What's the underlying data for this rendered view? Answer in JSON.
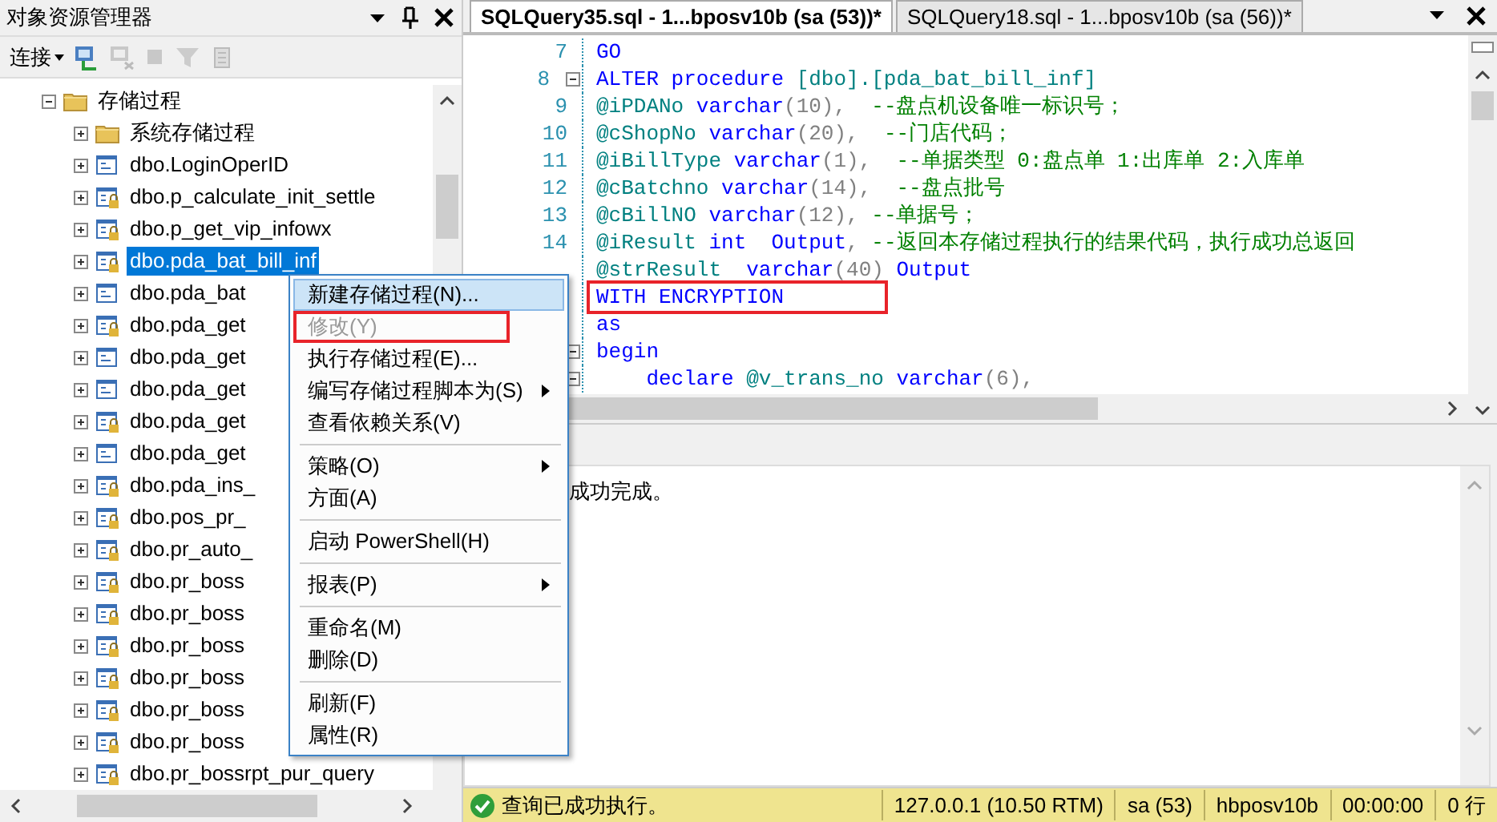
{
  "explorer": {
    "title": "对象资源管理器",
    "connect_label": "连接",
    "tree": [
      {
        "label": "存储过程",
        "kind": "folder",
        "expanded": true,
        "selected": false,
        "children": [
          {
            "label": "系统存储过程",
            "kind": "folder",
            "expanded": false,
            "selected": false
          },
          {
            "label": "dbo.LoginOperID",
            "kind": "procedure",
            "expanded": false,
            "selected": false
          },
          {
            "label": "dbo.p_calculate_init_settle",
            "kind": "locked",
            "expanded": false,
            "selected": false
          },
          {
            "label": "dbo.p_get_vip_infowx",
            "kind": "locked",
            "expanded": false,
            "selected": false
          },
          {
            "label": "dbo.pda_bat_bill_inf",
            "kind": "locked",
            "expanded": false,
            "selected": true
          },
          {
            "label": "dbo.pda_bat",
            "kind": "procedure",
            "expanded": false,
            "selected": false
          },
          {
            "label": "dbo.pda_get",
            "kind": "locked",
            "expanded": false,
            "selected": false
          },
          {
            "label": "dbo.pda_get",
            "kind": "procedure",
            "expanded": false,
            "selected": false
          },
          {
            "label": "dbo.pda_get",
            "kind": "procedure",
            "expanded": false,
            "selected": false
          },
          {
            "label": "dbo.pda_get",
            "kind": "locked",
            "expanded": false,
            "selected": false
          },
          {
            "label": "dbo.pda_get",
            "kind": "procedure",
            "expanded": false,
            "selected": false
          },
          {
            "label": "dbo.pda_ins_",
            "kind": "locked",
            "expanded": false,
            "selected": false
          },
          {
            "label": "dbo.pos_pr_",
            "kind": "locked",
            "expanded": false,
            "selected": false
          },
          {
            "label": "dbo.pr_auto_",
            "kind": "locked",
            "expanded": false,
            "selected": false
          },
          {
            "label": "dbo.pr_boss",
            "kind": "locked",
            "expanded": false,
            "selected": false
          },
          {
            "label": "dbo.pr_boss",
            "kind": "locked",
            "expanded": false,
            "selected": false
          },
          {
            "label": "dbo.pr_boss",
            "kind": "locked",
            "expanded": false,
            "selected": false
          },
          {
            "label": "dbo.pr_boss",
            "kind": "locked",
            "expanded": false,
            "selected": false
          },
          {
            "label": "dbo.pr_boss",
            "kind": "locked",
            "expanded": false,
            "selected": false
          },
          {
            "label": "dbo.pr_boss",
            "kind": "locked",
            "expanded": false,
            "selected": false
          },
          {
            "label": "dbo.pr_bossrpt_pur_query",
            "kind": "locked",
            "expanded": false,
            "selected": false
          }
        ]
      }
    ]
  },
  "tabs": [
    {
      "label": "SQLQuery35.sql - 1...bposv10b (sa (53))*",
      "selected": true
    },
    {
      "label": "SQLQuery18.sql - 1...bposv10b (sa (56))*",
      "selected": false
    }
  ],
  "editor": {
    "lines": [
      {
        "number": "7",
        "tokens": [
          {
            "kind": "keyword",
            "text": "GO"
          }
        ]
      },
      {
        "number": "8",
        "fold": true,
        "tokens": [
          {
            "kind": "keyword",
            "text": "ALTER procedure "
          },
          {
            "kind": "name",
            "text": "[dbo].[pda_bat_bill_inf]"
          }
        ]
      },
      {
        "number": "9",
        "tokens": [
          {
            "kind": "name",
            "text": "@iPDANo "
          },
          {
            "kind": "keyword",
            "text": "varchar"
          },
          {
            "kind": "punct",
            "text": "(10),  "
          },
          {
            "kind": "comment",
            "text": "--盘点机设备唯一标识号；"
          }
        ]
      },
      {
        "number": "10",
        "tokens": [
          {
            "kind": "name",
            "text": "@cShopNo "
          },
          {
            "kind": "keyword",
            "text": "varchar"
          },
          {
            "kind": "punct",
            "text": "(20),  "
          },
          {
            "kind": "comment",
            "text": "--门店代码；"
          }
        ]
      },
      {
        "number": "11",
        "tokens": [
          {
            "kind": "name",
            "text": "@iBillType "
          },
          {
            "kind": "keyword",
            "text": "varchar"
          },
          {
            "kind": "punct",
            "text": "(1),  "
          },
          {
            "kind": "comment",
            "text": "--单据类型 0:盘点单 1:出库单 2:入库单"
          }
        ]
      },
      {
        "number": "12",
        "tokens": [
          {
            "kind": "name",
            "text": "@cBatchno "
          },
          {
            "kind": "keyword",
            "text": "varchar"
          },
          {
            "kind": "punct",
            "text": "(14),  "
          },
          {
            "kind": "comment",
            "text": "--盘点批号"
          }
        ]
      },
      {
        "number": "13",
        "tokens": [
          {
            "kind": "name",
            "text": "@cBillNO "
          },
          {
            "kind": "keyword",
            "text": "varchar"
          },
          {
            "kind": "punct",
            "text": "(12), "
          },
          {
            "kind": "comment",
            "text": "--单据号；"
          }
        ]
      },
      {
        "number": "14",
        "tokens": [
          {
            "kind": "name",
            "text": "@iResult "
          },
          {
            "kind": "keyword",
            "text": "int  Output"
          },
          {
            "kind": "punct",
            "text": ", "
          },
          {
            "kind": "comment",
            "text": "--返回本存储过程执行的结果代码，执行成功总返回"
          }
        ]
      },
      {
        "tokens": [
          {
            "kind": "name",
            "text": "@strResult  "
          },
          {
            "kind": "keyword",
            "text": "varchar"
          },
          {
            "kind": "punct",
            "text": "(40) "
          },
          {
            "kind": "keyword",
            "text": "Output"
          }
        ]
      },
      {
        "annotated": true,
        "tokens": [
          {
            "kind": "keyword",
            "text": "WITH ENCRYPTION"
          }
        ]
      },
      {
        "tokens": [
          {
            "kind": "keyword",
            "text": "as"
          }
        ]
      },
      {
        "fold": true,
        "tokens": [
          {
            "kind": "keyword",
            "text": "begin"
          }
        ]
      },
      {
        "fold": true,
        "tokens": [
          {
            "kind": "keyword",
            "text": "    declare "
          },
          {
            "kind": "name",
            "text": "@v_trans_no "
          },
          {
            "kind": "keyword",
            "text": "varchar"
          },
          {
            "kind": "punct",
            "text": "(6),"
          }
        ]
      }
    ]
  },
  "messages": {
    "text": "成功完成。"
  },
  "context_menu": [
    {
      "kind": "item",
      "label": "新建存储过程(N)...",
      "selected": true,
      "disabled": false,
      "submenu": false,
      "annotated": false
    },
    {
      "kind": "item",
      "label": "修改(Y)",
      "selected": false,
      "disabled": true,
      "submenu": false,
      "annotated": true
    },
    {
      "kind": "item",
      "label": "执行存储过程(E)...",
      "selected": false,
      "disabled": false,
      "submenu": false,
      "annotated": false
    },
    {
      "kind": "item",
      "label": "编写存储过程脚本为(S)",
      "selected": false,
      "disabled": false,
      "submenu": true,
      "annotated": false
    },
    {
      "kind": "item",
      "label": "查看依赖关系(V)",
      "selected": false,
      "disabled": false,
      "submenu": false,
      "annotated": false
    },
    {
      "kind": "separator"
    },
    {
      "kind": "item",
      "label": "策略(O)",
      "selected": false,
      "disabled": false,
      "submenu": true,
      "annotated": false
    },
    {
      "kind": "item",
      "label": "方面(A)",
      "selected": false,
      "disabled": false,
      "submenu": false,
      "annotated": false
    },
    {
      "kind": "separator"
    },
    {
      "kind": "item",
      "label": "启动 PowerShell(H)",
      "selected": false,
      "disabled": false,
      "submenu": false,
      "annotated": false
    },
    {
      "kind": "separator"
    },
    {
      "kind": "item",
      "label": "报表(P)",
      "selected": false,
      "disabled": false,
      "submenu": true,
      "annotated": false
    },
    {
      "kind": "separator"
    },
    {
      "kind": "item",
      "label": "重命名(M)",
      "selected": false,
      "disabled": false,
      "submenu": false,
      "annotated": false
    },
    {
      "kind": "item",
      "label": "删除(D)",
      "selected": false,
      "disabled": false,
      "submenu": false,
      "annotated": false
    },
    {
      "kind": "separator"
    },
    {
      "kind": "item",
      "label": "刷新(F)",
      "selected": false,
      "disabled": false,
      "submenu": false,
      "annotated": false
    },
    {
      "kind": "item",
      "label": "属性(R)",
      "selected": false,
      "disabled": false,
      "submenu": false,
      "annotated": false
    }
  ],
  "status_bar": {
    "message": "查询已成功执行。",
    "fields": [
      "127.0.0.1 (10.50 RTM)",
      "sa (53)",
      "hbposv10b",
      "00:00:00",
      "0 行"
    ]
  }
}
